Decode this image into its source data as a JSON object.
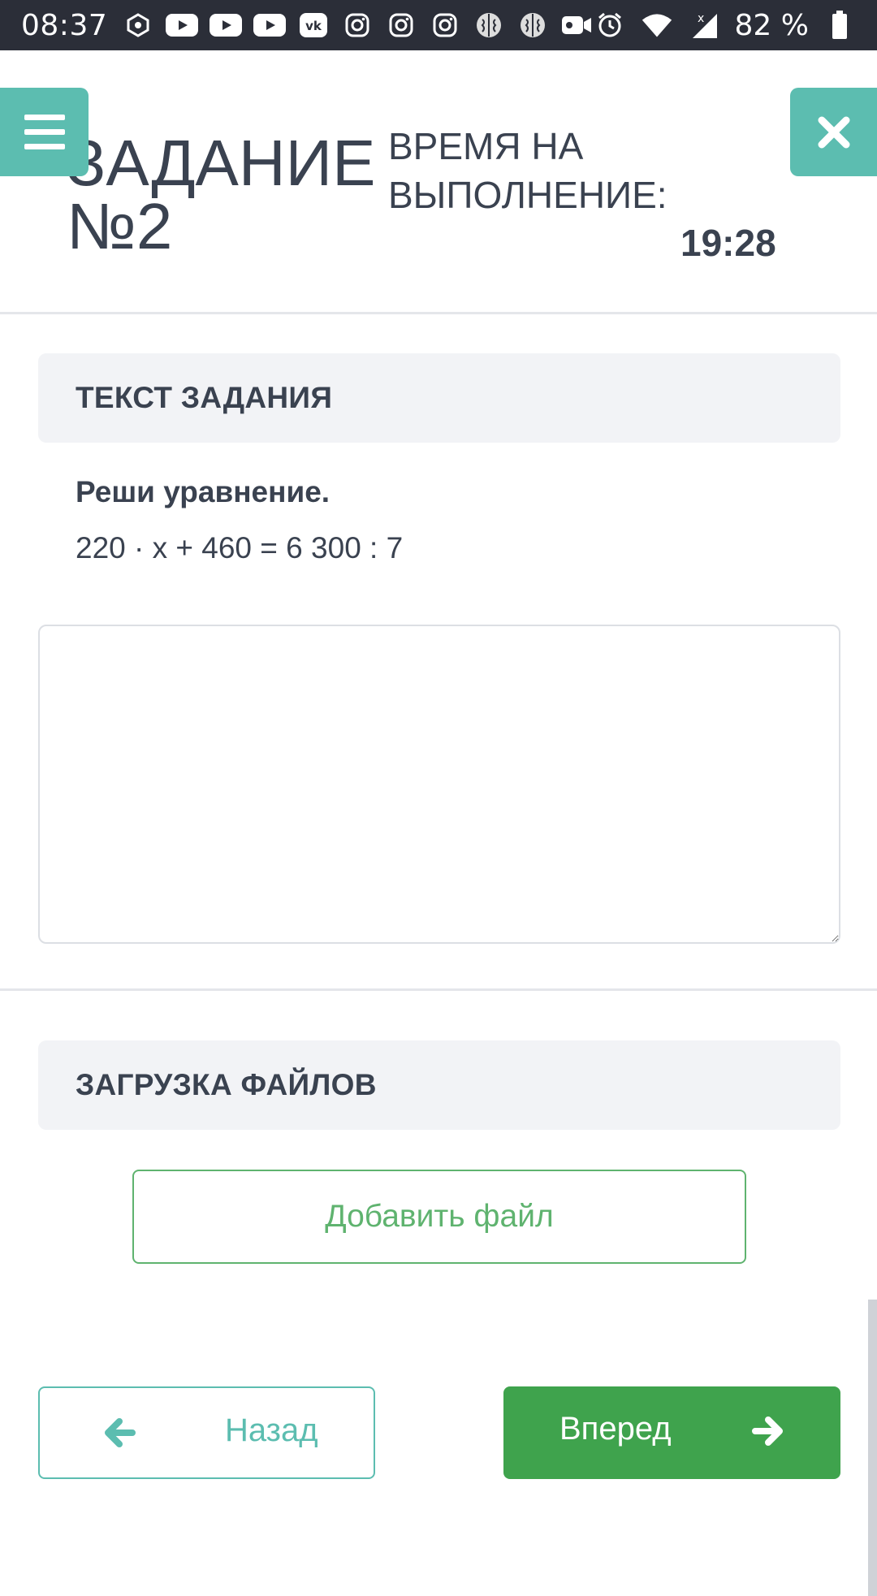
{
  "status_bar": {
    "time": "08:37",
    "battery": "82 %",
    "notification_icons": [
      "hexagon-icon",
      "youtube-icon",
      "youtube-icon",
      "youtube-icon",
      "vk-icon",
      "instagram-icon",
      "instagram-icon",
      "instagram-icon",
      "brain-icon",
      "brain-icon",
      "video-camera-icon"
    ],
    "system_icons": [
      "alarm-icon",
      "wifi-icon",
      "signal-icon",
      "battery-icon"
    ]
  },
  "header": {
    "task_title_line1": "ЗАДАНИЕ",
    "task_title_line2": "№2",
    "time_label_line1": "ВРЕМЯ НА",
    "time_label_line2": "ВЫПОЛНЕНИЕ:",
    "time_value": "19:28"
  },
  "task": {
    "section_title": "ТЕКСТ ЗАДАНИЯ",
    "prompt": "Реши уравнение.",
    "equation": "220 · x + 460 = 6 300 : 7",
    "answer_value": ""
  },
  "files": {
    "section_title": "ЗАГРУЗКА ФАЙЛОВ",
    "add_file_label": "Добавить файл"
  },
  "navigation": {
    "back_label": "Назад",
    "next_label": "Вперед"
  },
  "colors": {
    "teal": "#5cbdb0",
    "green": "#3fa34d",
    "light_green": "#5fb36f",
    "text": "#3a4250",
    "status_bar": "#2b2e38",
    "section_bg": "#f2f3f6"
  }
}
